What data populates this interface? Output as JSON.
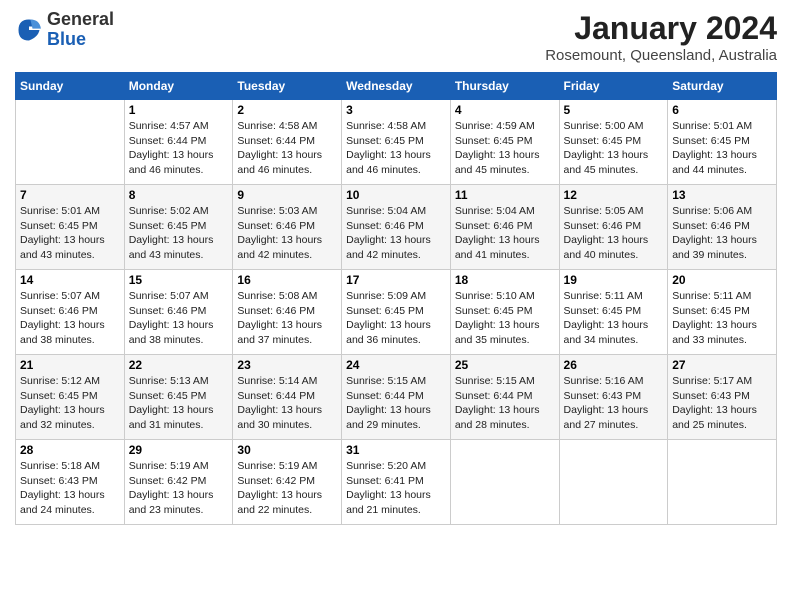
{
  "header": {
    "logo_general": "General",
    "logo_blue": "Blue",
    "month_year": "January 2024",
    "location": "Rosemount, Queensland, Australia"
  },
  "weekdays": [
    "Sunday",
    "Monday",
    "Tuesday",
    "Wednesday",
    "Thursday",
    "Friday",
    "Saturday"
  ],
  "weeks": [
    [
      {
        "day": "",
        "info": ""
      },
      {
        "day": "1",
        "info": "Sunrise: 4:57 AM\nSunset: 6:44 PM\nDaylight: 13 hours\nand 46 minutes."
      },
      {
        "day": "2",
        "info": "Sunrise: 4:58 AM\nSunset: 6:44 PM\nDaylight: 13 hours\nand 46 minutes."
      },
      {
        "day": "3",
        "info": "Sunrise: 4:58 AM\nSunset: 6:45 PM\nDaylight: 13 hours\nand 46 minutes."
      },
      {
        "day": "4",
        "info": "Sunrise: 4:59 AM\nSunset: 6:45 PM\nDaylight: 13 hours\nand 45 minutes."
      },
      {
        "day": "5",
        "info": "Sunrise: 5:00 AM\nSunset: 6:45 PM\nDaylight: 13 hours\nand 45 minutes."
      },
      {
        "day": "6",
        "info": "Sunrise: 5:01 AM\nSunset: 6:45 PM\nDaylight: 13 hours\nand 44 minutes."
      }
    ],
    [
      {
        "day": "7",
        "info": "Sunrise: 5:01 AM\nSunset: 6:45 PM\nDaylight: 13 hours\nand 43 minutes."
      },
      {
        "day": "8",
        "info": "Sunrise: 5:02 AM\nSunset: 6:45 PM\nDaylight: 13 hours\nand 43 minutes."
      },
      {
        "day": "9",
        "info": "Sunrise: 5:03 AM\nSunset: 6:46 PM\nDaylight: 13 hours\nand 42 minutes."
      },
      {
        "day": "10",
        "info": "Sunrise: 5:04 AM\nSunset: 6:46 PM\nDaylight: 13 hours\nand 42 minutes."
      },
      {
        "day": "11",
        "info": "Sunrise: 5:04 AM\nSunset: 6:46 PM\nDaylight: 13 hours\nand 41 minutes."
      },
      {
        "day": "12",
        "info": "Sunrise: 5:05 AM\nSunset: 6:46 PM\nDaylight: 13 hours\nand 40 minutes."
      },
      {
        "day": "13",
        "info": "Sunrise: 5:06 AM\nSunset: 6:46 PM\nDaylight: 13 hours\nand 39 minutes."
      }
    ],
    [
      {
        "day": "14",
        "info": "Sunrise: 5:07 AM\nSunset: 6:46 PM\nDaylight: 13 hours\nand 38 minutes."
      },
      {
        "day": "15",
        "info": "Sunrise: 5:07 AM\nSunset: 6:46 PM\nDaylight: 13 hours\nand 38 minutes."
      },
      {
        "day": "16",
        "info": "Sunrise: 5:08 AM\nSunset: 6:46 PM\nDaylight: 13 hours\nand 37 minutes."
      },
      {
        "day": "17",
        "info": "Sunrise: 5:09 AM\nSunset: 6:45 PM\nDaylight: 13 hours\nand 36 minutes."
      },
      {
        "day": "18",
        "info": "Sunrise: 5:10 AM\nSunset: 6:45 PM\nDaylight: 13 hours\nand 35 minutes."
      },
      {
        "day": "19",
        "info": "Sunrise: 5:11 AM\nSunset: 6:45 PM\nDaylight: 13 hours\nand 34 minutes."
      },
      {
        "day": "20",
        "info": "Sunrise: 5:11 AM\nSunset: 6:45 PM\nDaylight: 13 hours\nand 33 minutes."
      }
    ],
    [
      {
        "day": "21",
        "info": "Sunrise: 5:12 AM\nSunset: 6:45 PM\nDaylight: 13 hours\nand 32 minutes."
      },
      {
        "day": "22",
        "info": "Sunrise: 5:13 AM\nSunset: 6:45 PM\nDaylight: 13 hours\nand 31 minutes."
      },
      {
        "day": "23",
        "info": "Sunrise: 5:14 AM\nSunset: 6:44 PM\nDaylight: 13 hours\nand 30 minutes."
      },
      {
        "day": "24",
        "info": "Sunrise: 5:15 AM\nSunset: 6:44 PM\nDaylight: 13 hours\nand 29 minutes."
      },
      {
        "day": "25",
        "info": "Sunrise: 5:15 AM\nSunset: 6:44 PM\nDaylight: 13 hours\nand 28 minutes."
      },
      {
        "day": "26",
        "info": "Sunrise: 5:16 AM\nSunset: 6:43 PM\nDaylight: 13 hours\nand 27 minutes."
      },
      {
        "day": "27",
        "info": "Sunrise: 5:17 AM\nSunset: 6:43 PM\nDaylight: 13 hours\nand 25 minutes."
      }
    ],
    [
      {
        "day": "28",
        "info": "Sunrise: 5:18 AM\nSunset: 6:43 PM\nDaylight: 13 hours\nand 24 minutes."
      },
      {
        "day": "29",
        "info": "Sunrise: 5:19 AM\nSunset: 6:42 PM\nDaylight: 13 hours\nand 23 minutes."
      },
      {
        "day": "30",
        "info": "Sunrise: 5:19 AM\nSunset: 6:42 PM\nDaylight: 13 hours\nand 22 minutes."
      },
      {
        "day": "31",
        "info": "Sunrise: 5:20 AM\nSunset: 6:41 PM\nDaylight: 13 hours\nand 21 minutes."
      },
      {
        "day": "",
        "info": ""
      },
      {
        "day": "",
        "info": ""
      },
      {
        "day": "",
        "info": ""
      }
    ]
  ]
}
